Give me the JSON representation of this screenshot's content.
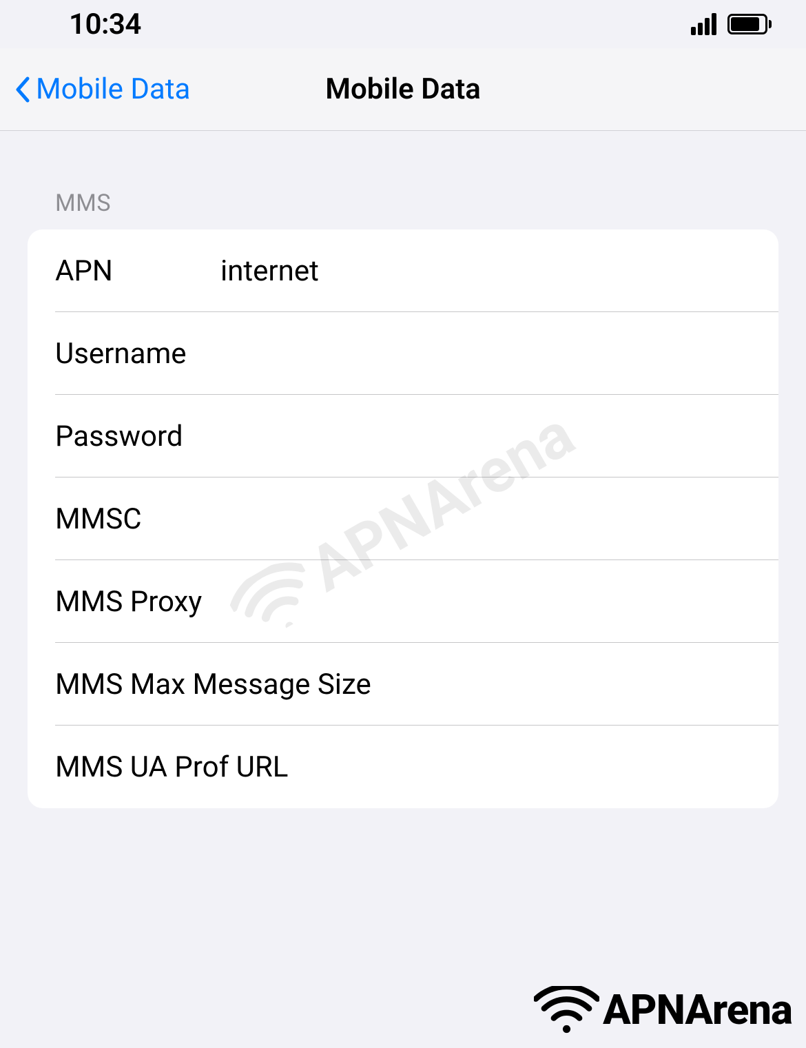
{
  "statusBar": {
    "time": "10:34"
  },
  "navBar": {
    "backLabel": "Mobile Data",
    "title": "Mobile Data"
  },
  "section": {
    "header": "MMS",
    "rows": [
      {
        "label": "APN",
        "value": "internet"
      },
      {
        "label": "Username",
        "value": ""
      },
      {
        "label": "Password",
        "value": ""
      },
      {
        "label": "MMSC",
        "value": ""
      },
      {
        "label": "MMS Proxy",
        "value": ""
      },
      {
        "label": "MMS Max Message Size",
        "value": ""
      },
      {
        "label": "MMS UA Prof URL",
        "value": ""
      }
    ]
  },
  "brand": {
    "name": "APNArena"
  }
}
